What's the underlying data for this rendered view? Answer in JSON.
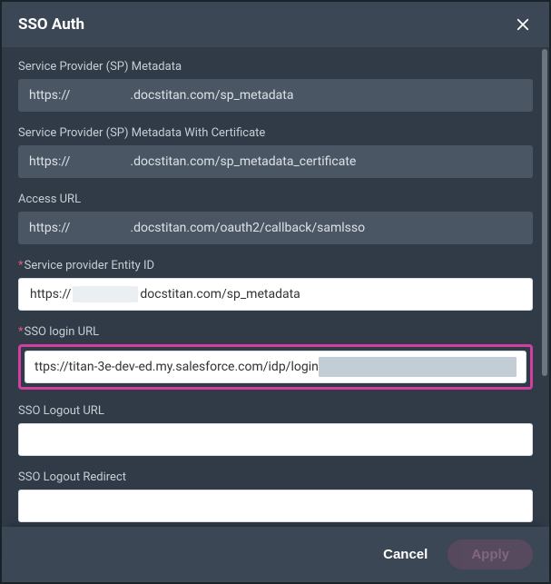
{
  "modal": {
    "title": "SSO Auth"
  },
  "fields": {
    "sp_metadata": {
      "label": "Service Provider (SP) Metadata",
      "proto": "https://",
      "rest": ".docstitan.com/sp_metadata"
    },
    "sp_metadata_cert": {
      "label": "Service Provider (SP) Metadata With Certificate",
      "proto": "https://",
      "rest": ".docstitan.com/sp_metadata_certificate"
    },
    "access_url": {
      "label": "Access URL",
      "proto": "https://",
      "rest": ".docstitan.com/oauth2/callback/samlsso"
    },
    "entity_id": {
      "label": "Service provider Entity ID",
      "pre": "https://",
      "post": "docstitan.com/sp_metadata"
    },
    "login_url": {
      "label": "SSO login URL",
      "value": "ttps://titan-3e-dev-ed.my.salesforce.com/idp/login"
    },
    "logout_url": {
      "label": "SSO Logout URL",
      "value": ""
    },
    "logout_redirect": {
      "label": "SSO Logout Redirect",
      "value": ""
    }
  },
  "footer": {
    "cancel": "Cancel",
    "apply": "Apply"
  }
}
